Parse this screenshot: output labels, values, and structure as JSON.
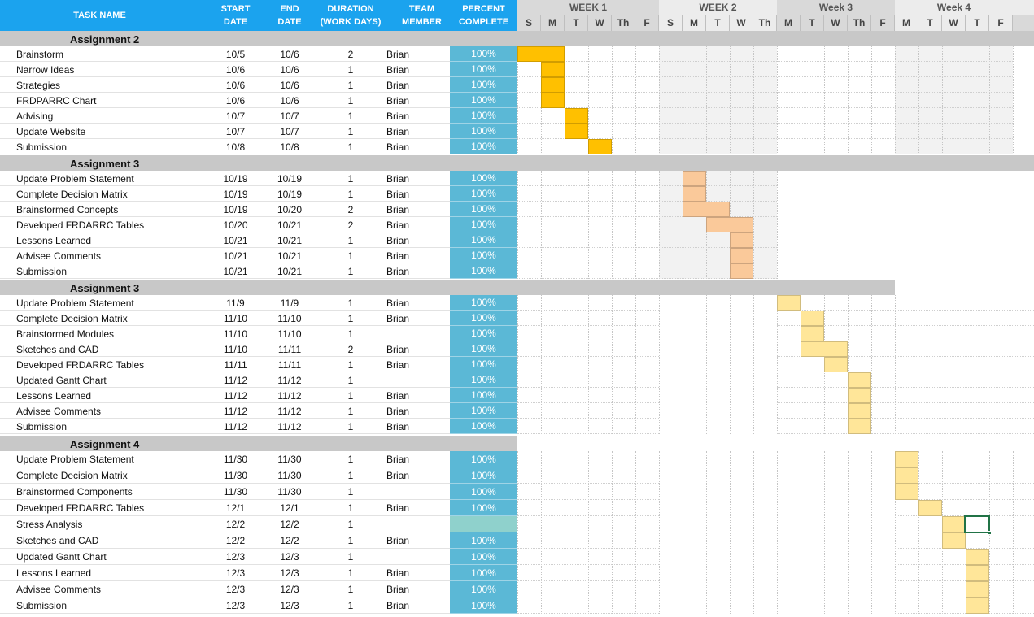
{
  "header": {
    "task_name": "TASK NAME",
    "start_date": "START\nDATE",
    "end_date": "END DATE",
    "duration": "DURATION\n(WORK DAYS)",
    "team_member": "TEAM\nMEMBER",
    "percent_complete": "PERCENT\nCOMPLETE"
  },
  "weeks": [
    "WEEK 1",
    "WEEK 2",
    "Week 3",
    "Week 4"
  ],
  "day_headers": [
    "S",
    "M",
    "T",
    "W",
    "Th",
    "F",
    "S",
    "M",
    "T",
    "W",
    "Th",
    "M",
    "T",
    "W",
    "Th",
    "F",
    "M",
    "T",
    "W",
    "T",
    "F"
  ],
  "colors": {
    "header_blue": "#1ba3ee",
    "percent_cell": "#5bb8d6",
    "section_gray": "#c8c8c8",
    "assignment2_bar": "#ffc000",
    "assignment3_bar": "#fac99a",
    "assignment3b_bar": "#ffe699",
    "assignment4_bar": "#ffe699",
    "selection": "#217346"
  },
  "sections": [
    {
      "title": "Assignment 2",
      "tasks": [
        {
          "name": "Brainstorm",
          "start": "10/5",
          "end": "10/6",
          "duration": "2",
          "member": "Brian",
          "percent": "100%"
        },
        {
          "name": "Narrow Ideas",
          "start": "10/6",
          "end": "10/6",
          "duration": "1",
          "member": "Brian",
          "percent": "100%"
        },
        {
          "name": "Strategies",
          "start": "10/6",
          "end": "10/6",
          "duration": "1",
          "member": "Brian",
          "percent": "100%"
        },
        {
          "name": "FRDPARRC Chart",
          "start": "10/6",
          "end": "10/6",
          "duration": "1",
          "member": "Brian",
          "percent": "100%"
        },
        {
          "name": "Advising",
          "start": "10/7",
          "end": "10/7",
          "duration": "1",
          "member": "Brian",
          "percent": "100%"
        },
        {
          "name": "Update Website",
          "start": "10/7",
          "end": "10/7",
          "duration": "1",
          "member": "Brian",
          "percent": "100%"
        },
        {
          "name": "Submission",
          "start": "10/8",
          "end": "10/8",
          "duration": "1",
          "member": "Brian",
          "percent": "100%"
        }
      ]
    },
    {
      "title": "Assignment 3",
      "tasks": [
        {
          "name": "Update Problem Statement",
          "start": "10/19",
          "end": "10/19",
          "duration": "1",
          "member": "Brian",
          "percent": "100%"
        },
        {
          "name": "Complete Decision Matrix",
          "start": "10/19",
          "end": "10/19",
          "duration": "1",
          "member": "Brian",
          "percent": "100%"
        },
        {
          "name": "Brainstormed Concepts",
          "start": "10/19",
          "end": "10/20",
          "duration": "2",
          "member": "Brian",
          "percent": "100%"
        },
        {
          "name": "Developed FRDARRC Tables",
          "start": "10/20",
          "end": "10/21",
          "duration": "2",
          "member": "Brian",
          "percent": "100%"
        },
        {
          "name": "Lessons Learned",
          "start": "10/21",
          "end": "10/21",
          "duration": "1",
          "member": "Brian",
          "percent": "100%"
        },
        {
          "name": "Advisee Comments",
          "start": "10/21",
          "end": "10/21",
          "duration": "1",
          "member": "Brian",
          "percent": "100%"
        },
        {
          "name": "Submission",
          "start": "10/21",
          "end": "10/21",
          "duration": "1",
          "member": "Brian",
          "percent": "100%"
        }
      ]
    },
    {
      "title": "Assignment 3",
      "tasks": [
        {
          "name": "Update Problem Statement",
          "start": "11/9",
          "end": "11/9",
          "duration": "1",
          "member": "Brian",
          "percent": "100%"
        },
        {
          "name": "Complete Decision Matrix",
          "start": "11/10",
          "end": "11/10",
          "duration": "1",
          "member": "Brian",
          "percent": "100%"
        },
        {
          "name": "Brainstormed Modules",
          "start": "11/10",
          "end": "11/10",
          "duration": "1",
          "member": "",
          "percent": "100%"
        },
        {
          "name": "Sketches and CAD",
          "start": "11/10",
          "end": "11/11",
          "duration": "2",
          "member": "Brian",
          "percent": "100%"
        },
        {
          "name": "Developed FRDARRC Tables",
          "start": "11/11",
          "end": "11/11",
          "duration": "1",
          "member": "Brian",
          "percent": "100%"
        },
        {
          "name": "Updated Gantt Chart",
          "start": "11/12",
          "end": "11/12",
          "duration": "1",
          "member": "",
          "percent": "100%"
        },
        {
          "name": "Lessons Learned",
          "start": "11/12",
          "end": "11/12",
          "duration": "1",
          "member": "Brian",
          "percent": "100%"
        },
        {
          "name": "Advisee Comments",
          "start": "11/12",
          "end": "11/12",
          "duration": "1",
          "member": "Brian",
          "percent": "100%"
        },
        {
          "name": "Submission",
          "start": "11/12",
          "end": "11/12",
          "duration": "1",
          "member": "Brian",
          "percent": "100%"
        }
      ]
    },
    {
      "title": "Assignment 4",
      "tasks": [
        {
          "name": "Update Problem Statement",
          "start": "11/30",
          "end": "11/30",
          "duration": "1",
          "member": "Brian",
          "percent": "100%"
        },
        {
          "name": "Complete Decision Matrix",
          "start": "11/30",
          "end": "11/30",
          "duration": "1",
          "member": "Brian",
          "percent": "100%"
        },
        {
          "name": "Brainstormed Components",
          "start": "11/30",
          "end": "11/30",
          "duration": "1",
          "member": "",
          "percent": "100%"
        },
        {
          "name": "Developed FRDARRC Tables",
          "start": "12/1",
          "end": "12/1",
          "duration": "1",
          "member": "Brian",
          "percent": "100%"
        },
        {
          "name": "Stress Analysis",
          "start": "12/2",
          "end": "12/2",
          "duration": "1",
          "member": "",
          "percent": ""
        },
        {
          "name": "Sketches and CAD",
          "start": "12/2",
          "end": "12/2",
          "duration": "1",
          "member": "Brian",
          "percent": "100%"
        },
        {
          "name": "Updated Gantt Chart",
          "start": "12/3",
          "end": "12/3",
          "duration": "1",
          "member": "",
          "percent": "100%"
        },
        {
          "name": "Lessons Learned",
          "start": "12/3",
          "end": "12/3",
          "duration": "1",
          "member": "Brian",
          "percent": "100%"
        },
        {
          "name": "Advisee Comments",
          "start": "12/3",
          "end": "12/3",
          "duration": "1",
          "member": "Brian",
          "percent": "100%"
        },
        {
          "name": "Submission",
          "start": "12/3",
          "end": "12/3",
          "duration": "1",
          "member": "Brian",
          "percent": "100%"
        }
      ]
    }
  ]
}
